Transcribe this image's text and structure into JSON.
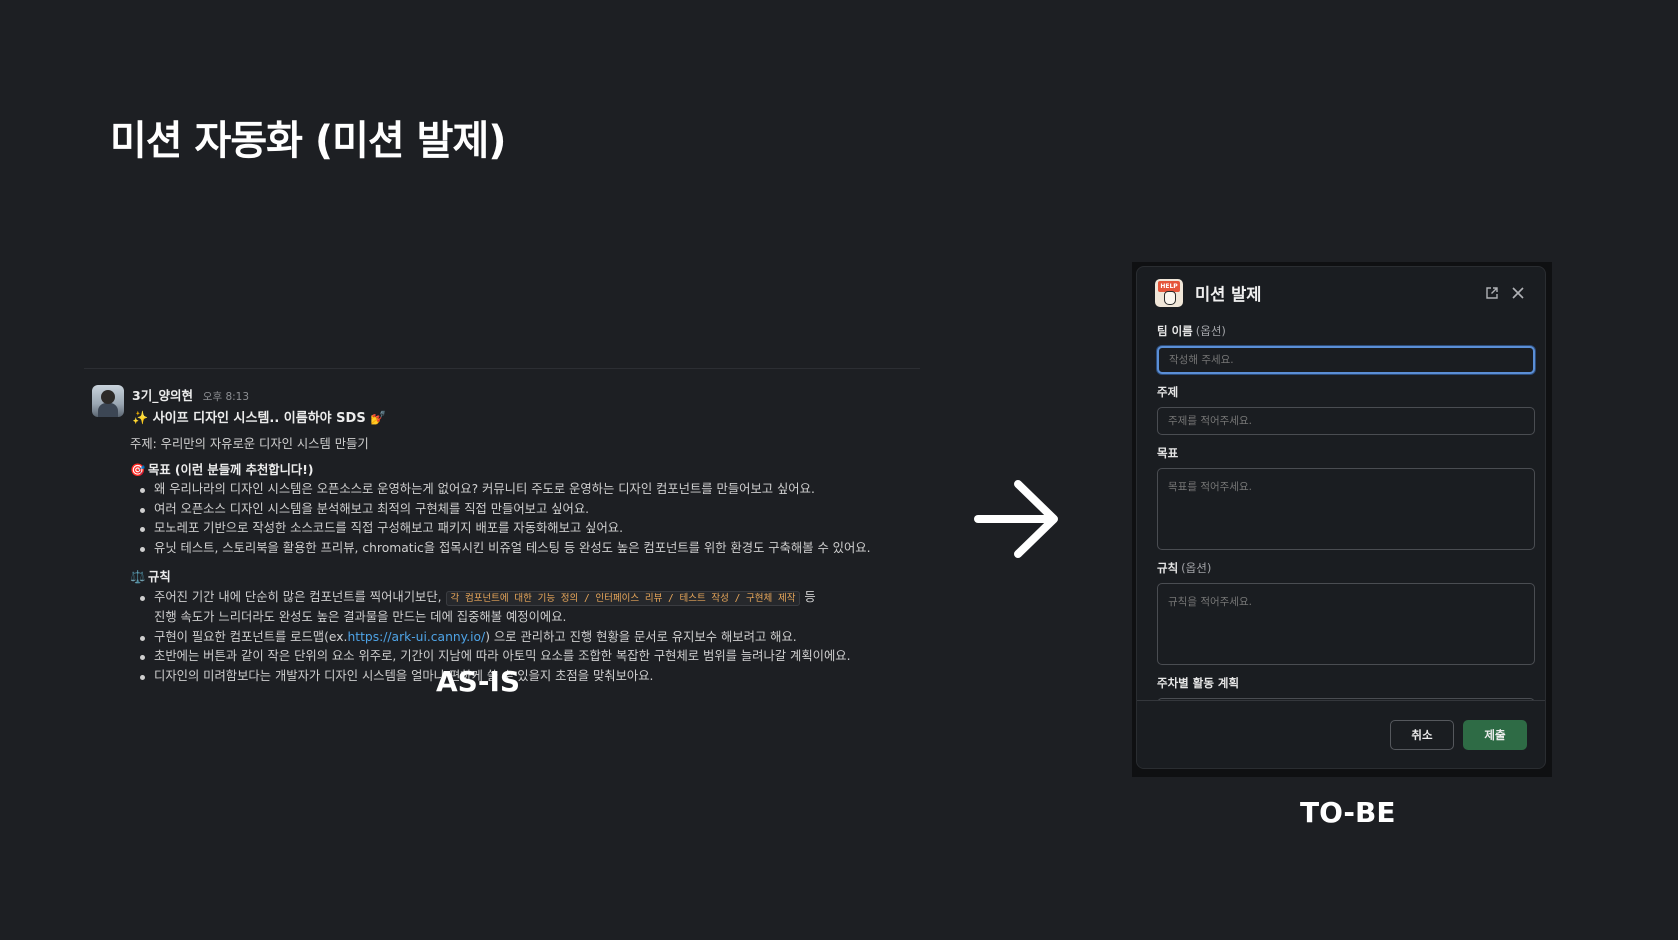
{
  "slide": {
    "title": "미션 자동화 (미션 발제)",
    "asis_label": "AS-IS",
    "tobe_label": "TO-BE"
  },
  "message": {
    "author": "3기_양의현",
    "time": "오후 8:13",
    "headline": "✨ 사이프 디자인 시스템.. 이름하야 SDS 💅",
    "topic": "주제: 우리만의 자유로운 디자인 시스템 만들기",
    "goal_title": "목표 (이런 분들께 추천합니다!)",
    "goal_icon": "🎯",
    "goals": [
      "왜 우리나라의 디자인 시스템은 오픈소스로 운영하는게 없어요? 커뮤니티 주도로 운영하는 디자인 컴포넌트를 만들어보고 싶어요.",
      "여러 오픈소스 디자인 시스템을 분석해보고 최적의 구현체를 직접 만들어보고 싶어요.",
      "모노레포 기반으로 작성한 소스코드를 직접 구성해보고 패키지 배포를 자동화해보고 싶어요.",
      "유닛 테스트, 스토리북을 활용한 프리뷰, chromatic을 접목시킨 비쥬얼 테스팅 등 완성도 높은 컴포넌트를 위한 환경도 구축해볼 수 있어요."
    ],
    "rules_title": "규칙",
    "rules_icon": "⚖️",
    "rule1_pre": "주어진 기간 내에 단순히 많은 컴포넌트를 찍어내기보단,",
    "rule1_code": "각 컴포넌트에 대한 기능 정의 / 인터페이스 리뷰 / 테스트 작성 / 구현체 제작",
    "rule1_post": "등",
    "rule1_cont": "진행 속도가 느리더라도 완성도 높은 결과물을 만드는 데에 집중해볼 예정이에요.",
    "rule2_pre": "구현이 필요한 컴포넌트를 로드맵(ex.",
    "rule2_link": "https://ark-ui.canny.io/",
    "rule2_post": ") 으로 관리하고 진행 현황을 문서로 유지보수 해보려고 해요.",
    "rule3": "초반에는 버튼과 같이 작은 단위의 요소 위주로, 기간이 지남에 따라 아토믹 요소를 조합한 복잡한 구현체로 범위를 늘려나갈 계획이에요.",
    "rule4": "디자인의 미려함보다는 개발자가 디자인 시스템을 얼마나 편하게 쓸 수 있을지 초점을 맞춰보아요."
  },
  "modal": {
    "title": "미션 발제",
    "app_icon_text": "HELP",
    "team_label": "팀 이름",
    "team_optional": "(옵션)",
    "team_placeholder": "작성해 주세요.",
    "topic_label": "주제",
    "topic_placeholder": "주제를 적어주세요.",
    "goal_label": "목표",
    "goal_placeholder": "목표를 적어주세요.",
    "rules_label": "규칙",
    "rules_optional": "(옵션)",
    "rules_placeholder": "규칙을 적어주세요.",
    "weekly_label": "주차별 활동 계획",
    "cancel": "취소",
    "submit": "제출"
  },
  "colors": {
    "background": "#1d1f23",
    "submit": "#2e6b45",
    "focus": "#5b8fd6",
    "link": "#4ea3e6",
    "code": "#e8a75a"
  }
}
